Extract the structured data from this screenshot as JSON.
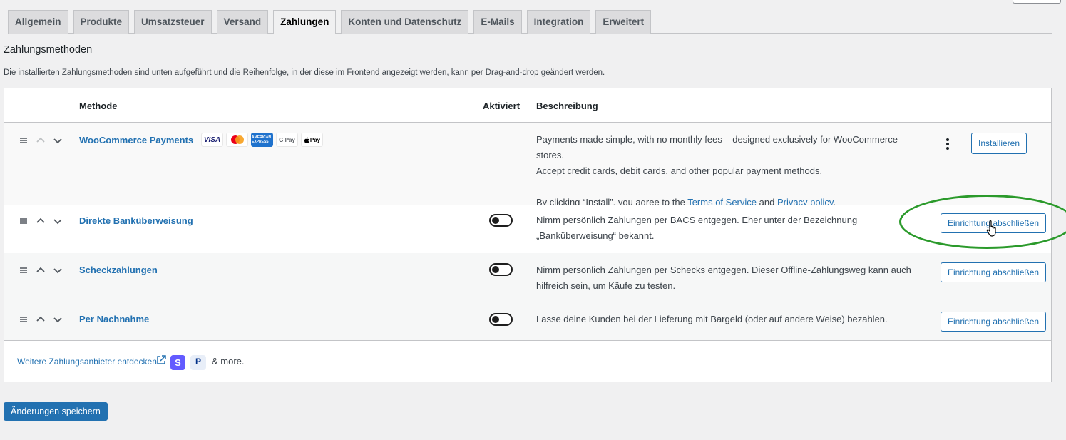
{
  "tabs": [
    "Allgemein",
    "Produkte",
    "Umsatzsteuer",
    "Versand",
    "Zahlungen",
    "Konten und Datenschutz",
    "E-Mails",
    "Integration",
    "Erweitert"
  ],
  "active_tab": "Zahlungen",
  "page": {
    "title": "Zahlungsmethoden",
    "intro": "Die installierten Zahlungsmethoden sind unten aufgeführt und die Reihenfolge, in der diese im Frontend angezeigt werden, kann per Drag-and-drop geändert werden."
  },
  "table": {
    "headers": {
      "method": "Methode",
      "enabled": "Aktiviert",
      "description": "Beschreibung"
    },
    "rows": [
      {
        "name": "WooCommerce Payments",
        "cards": [
          "VISA",
          "Mastercard",
          "American Express",
          "G Pay",
          "Apple Pay"
        ],
        "card_labels": {
          "visa": "VISA",
          "amex": "AMERICAN EXPRESS",
          "gpay": "G Pay",
          "apay": "Pay"
        },
        "description_1": "Payments made simple, with no monthly fees – designed exclusively for WooCommerce stores.",
        "description_2": "Accept credit cards, debit cards, and other popular payment methods.",
        "legal_prefix": "By clicking “Install”, you agree to the ",
        "terms_link": "Terms of Service",
        "legal_and": " and ",
        "privacy_link": "Privacy policy",
        "legal_suffix": ".",
        "button": "Installieren"
      },
      {
        "name": "Direkte Banküberweisung",
        "enabled": false,
        "description": "Nimm persönlich Zahlungen per BACS entgegen. Eher unter der Bezeichnung „Banküberweisung“ bekannt.",
        "button": "Einrichtung abschließen"
      },
      {
        "name": "Scheckzahlungen",
        "enabled": false,
        "description": "Nimm persönlich Zahlungen per Schecks entgegen. Dieser Offline-Zahlungsweg kann auch hilfreich sein, um Käufe zu testen.",
        "button": "Einrichtung abschließen"
      },
      {
        "name": "Per Nachnahme",
        "enabled": false,
        "description": "Lasse deine Kunden bei der Lieferung mit Bargeld (oder auf andere Weise) bezahlen.",
        "button": "Einrichtung abschließen"
      }
    ],
    "footer": {
      "discover_link": "Weitere Zahlungsanbieter entdecken",
      "stripe_letter": "S",
      "paypal_letter": "P",
      "more": "& more."
    }
  },
  "save_button": "Änderungen speichern",
  "colors": {
    "link": "#2271b1",
    "primary": "#2271b1",
    "highlight": "#2b9a2b",
    "background": "#f0f0f1"
  },
  "icons": [
    "drag-handle-icon",
    "chevron-up-icon",
    "chevron-down-icon",
    "kebab-menu-icon",
    "external-link-icon",
    "hand-cursor-icon"
  ]
}
